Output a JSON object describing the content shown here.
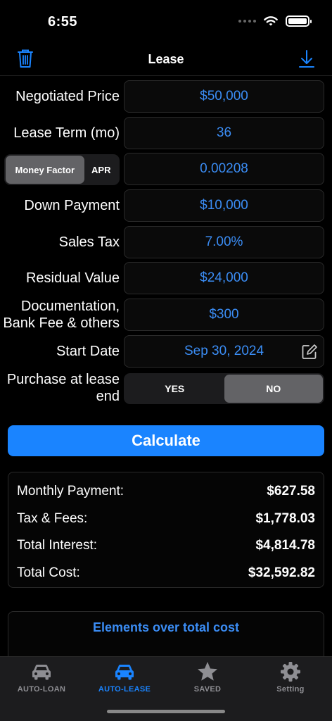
{
  "status": {
    "time": "6:55"
  },
  "nav": {
    "title": "Lease"
  },
  "form": {
    "negotiated_price": {
      "label": "Negotiated Price",
      "value": "$50,000"
    },
    "lease_term": {
      "label": "Lease Term (mo)",
      "value": "36"
    },
    "rate_toggle": {
      "option_a": "Money Factor",
      "option_b": "APR",
      "selected": "Money Factor",
      "value": "0.00208"
    },
    "down_payment": {
      "label": "Down Payment",
      "value": "$10,000"
    },
    "sales_tax": {
      "label": "Sales Tax",
      "value": "7.00%"
    },
    "residual_value": {
      "label": "Residual Value",
      "value": "$24,000"
    },
    "doc_fees": {
      "label": "Documentation, Bank Fee & others",
      "value": "$300"
    },
    "start_date": {
      "label": "Start Date",
      "value": "Sep 30, 2024"
    },
    "purchase": {
      "label": "Purchase at lease end",
      "yes": "YES",
      "no": "NO",
      "selected": "NO"
    }
  },
  "calculate_label": "Calculate",
  "results": [
    {
      "label": "Monthly Payment:",
      "value": "$627.58"
    },
    {
      "label": "Tax & Fees:",
      "value": "$1,778.03"
    },
    {
      "label": "Total Interest:",
      "value": "$4,814.78"
    },
    {
      "label": "Total Cost:",
      "value": "$32,592.82"
    }
  ],
  "chart": {
    "title": "Elements over total cost"
  },
  "tabs": [
    {
      "label": "AUTO-LOAN",
      "icon": "car-icon",
      "active": false
    },
    {
      "label": "AUTO-LEASE",
      "icon": "car-icon",
      "active": true
    },
    {
      "label": "SAVED",
      "icon": "star-icon",
      "active": false
    },
    {
      "label": "Setting",
      "icon": "gear-icon",
      "active": false
    }
  ],
  "colors": {
    "accent": "#1a84ff",
    "value_text": "#3b8df5",
    "pie_green": "#34c759",
    "pie_orange": "#f5a623",
    "pie_blue": "#1a84ff"
  }
}
